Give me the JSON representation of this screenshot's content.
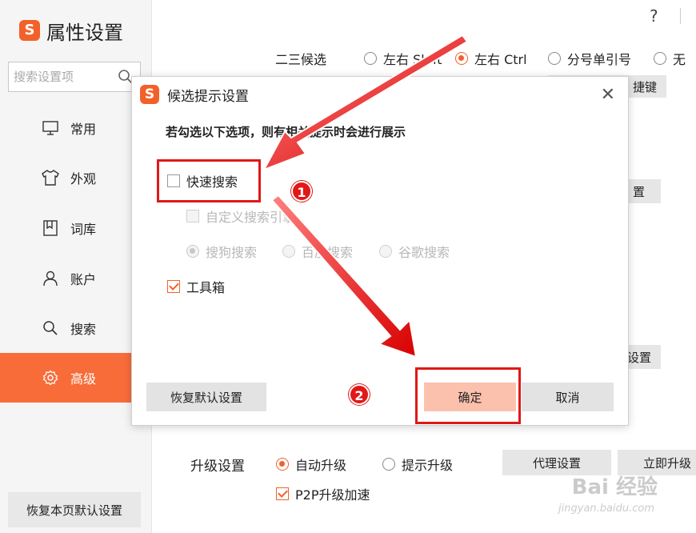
{
  "app": {
    "title": "属性设置",
    "logo": "S"
  },
  "sidebar": {
    "search_placeholder": "搜索设置项",
    "items": [
      {
        "label": "常用",
        "icon": "monitor-icon"
      },
      {
        "label": "外观",
        "icon": "shirt-icon"
      },
      {
        "label": "词库",
        "icon": "bookmark-icon"
      },
      {
        "label": "账户",
        "icon": "user-icon"
      },
      {
        "label": "搜索",
        "icon": "search-icon"
      },
      {
        "label": "高级",
        "icon": "gear-icon",
        "active": true
      }
    ],
    "restore_label": "恢复本页默认设置"
  },
  "topbar": {
    "help": "?"
  },
  "main": {
    "candidate_row": {
      "label": "二三候选",
      "options": [
        "左右 Shift",
        "左右 Ctrl",
        "分号单引号",
        "无"
      ],
      "selected": "左右 Ctrl"
    },
    "partial_buttons": [
      "捷键",
      "置",
      "设置"
    ],
    "upgrade": {
      "label": "升级设置",
      "options": [
        "自动升级",
        "提示升级"
      ],
      "selected": "自动升级",
      "proxy_label": "代理设置",
      "upgrade_now_label": "立即升级",
      "p2p_label": "P2P升级加速",
      "p2p_checked": true
    }
  },
  "dialog": {
    "logo": "S",
    "title": "候选提示设置",
    "close": "✕",
    "description": "若勾选以下选项，则有相关提示时会进行展示",
    "quick_search": {
      "label": "快速搜索",
      "checked": false
    },
    "custom_engine": {
      "label": "自定义搜索引擎",
      "checked": false,
      "disabled": true
    },
    "engines": [
      "搜狗搜索",
      "百度搜索",
      "谷歌搜索"
    ],
    "engine_selected": "搜狗搜索",
    "toolbox": {
      "label": "工具箱",
      "checked": true
    },
    "restore_label": "恢复默认设置",
    "ok_label": "确定",
    "cancel_label": "取消"
  },
  "annotations": {
    "badge1": "1",
    "badge2": "2",
    "color": "#e01818"
  },
  "colors": {
    "accent": "#f86c3a",
    "brand": "#f2612a",
    "primary_button": "#fcc1ad"
  },
  "watermark": {
    "brand": "Bai 经验",
    "url": "jingyan.baidu.com"
  }
}
